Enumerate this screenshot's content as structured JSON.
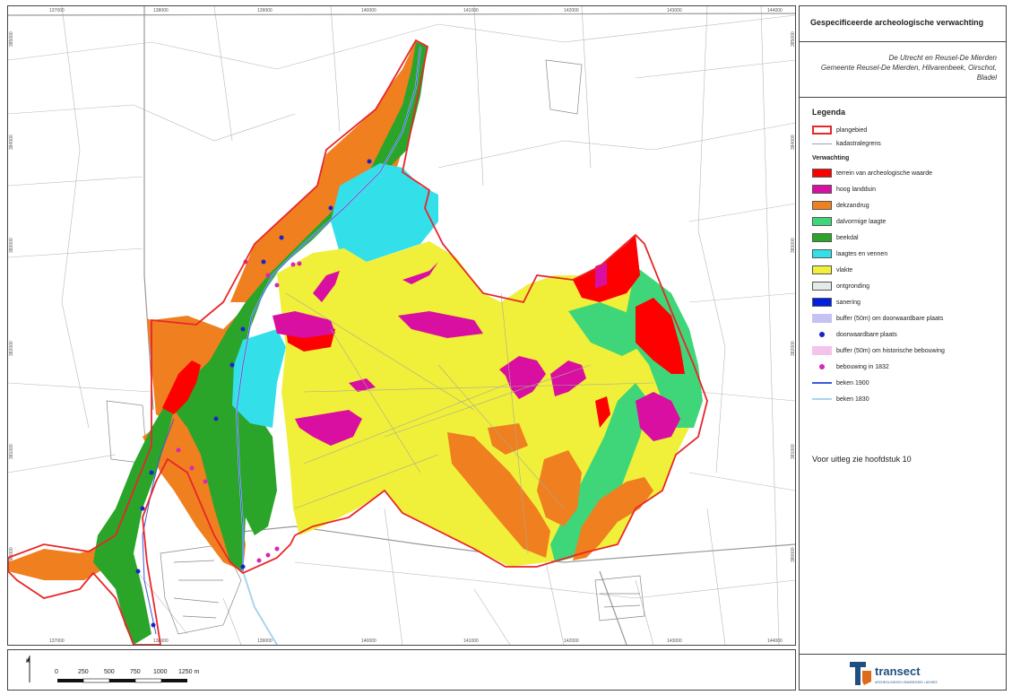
{
  "title": "Gespecificeerde archeologische verwachting",
  "subtitle_lines": [
    "De Utrecht en Reusel-De Mierden",
    "Gemeente Reusel-De Mierden, Hilvarenbeek, Oirschot,",
    "Bladel"
  ],
  "legend": {
    "title": "Legenda",
    "base_items": [
      {
        "label": "plangebied",
        "symbol": "outline",
        "color": "#e8262a"
      },
      {
        "label": "kadastralegrens",
        "symbol": "line",
        "color": "#8fa6b8"
      }
    ],
    "section_title": "Verwachting",
    "items": [
      {
        "label": "terrein van archeologische waarde",
        "symbol": "fill",
        "color": "#ff0000"
      },
      {
        "label": "hoog landduin",
        "symbol": "fill",
        "color": "#d80fa0"
      },
      {
        "label": "dekzandrug",
        "symbol": "fill",
        "color": "#f07f20"
      },
      {
        "label": "dalvormige laagte",
        "symbol": "fill",
        "color": "#3fd67a"
      },
      {
        "label": "beekdal",
        "symbol": "fill",
        "color": "#2aa52a"
      },
      {
        "label": "laagtes en vennen",
        "symbol": "fill",
        "color": "#33e0ea"
      },
      {
        "label": "vlakte",
        "symbol": "fill",
        "color": "#f0f03a"
      },
      {
        "label": "ontgronding",
        "symbol": "fill",
        "color": "#e3eae8"
      },
      {
        "label": "sanering",
        "symbol": "fill",
        "color": "#0020e0"
      },
      {
        "label": "buffer (50m) om doorwaardbare plaats",
        "symbol": "fill",
        "color": "#c4c2f2"
      },
      {
        "label": "doorwaardbare plaats",
        "symbol": "dot",
        "color": "#1a23c8"
      },
      {
        "label": "buffer (50m) om historische bebouwing",
        "symbol": "fill",
        "color": "#f4c2ea"
      },
      {
        "label": "bebouwing in 1832",
        "symbol": "dot",
        "color": "#d826b8"
      },
      {
        "label": "beken 1900",
        "symbol": "line",
        "color": "#3a5ad8"
      },
      {
        "label": "beken 1830",
        "symbol": "line",
        "color": "#a8d4ee"
      }
    ]
  },
  "note": "Voor uitleg zie hoofdstuk 10",
  "grid": {
    "x_labels": [
      "137000",
      "138000",
      "139000",
      "140000",
      "141000",
      "142000",
      "143000",
      "144000"
    ],
    "y_labels": [
      "385000",
      "384000",
      "383000",
      "382000",
      "381000",
      "380000"
    ]
  },
  "scalebar": {
    "labels": [
      "0",
      "250",
      "500",
      "750",
      "1000",
      "1250 m"
    ]
  },
  "north_arrow": {
    "label": "N"
  },
  "logo": {
    "name": "transect",
    "tagline": "ARCHEOLOGISCH ONDERZOEK • ADVIES",
    "color": "#1f4f80",
    "accent": "#e06a1a"
  }
}
